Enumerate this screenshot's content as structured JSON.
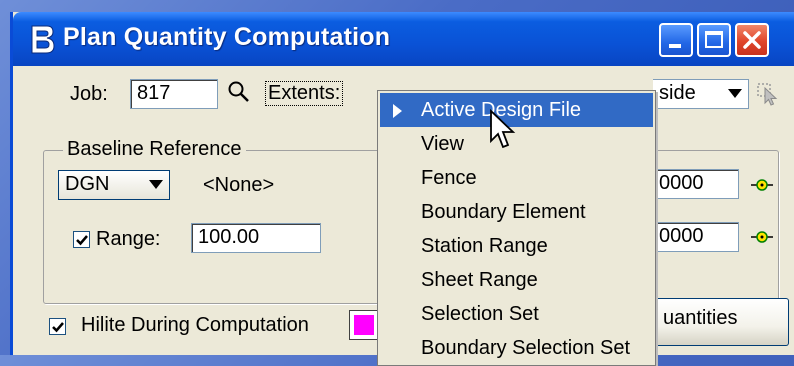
{
  "window": {
    "title": "Plan Quantity Computation"
  },
  "job": {
    "label": "Job:",
    "value": "817"
  },
  "extents": {
    "label": "Extents:",
    "selected_right_fragment": "side"
  },
  "baseline": {
    "group_label": "Baseline Reference",
    "source_value": "DGN",
    "element_value": "<None>",
    "range_checked": true,
    "range_label": "Range:",
    "range_value": "100.00",
    "right_field_1": "0000",
    "right_field_2": "0000"
  },
  "hilite": {
    "checked": true,
    "label": "Hilite During Computation",
    "color": "#ff00ff"
  },
  "quantities_button": {
    "label_fragment": "uantities"
  },
  "extents_menu": {
    "items": [
      {
        "label": "Active Design File",
        "selected": true
      },
      {
        "label": "View",
        "selected": false
      },
      {
        "label": "Fence",
        "selected": false
      },
      {
        "label": "Boundary Element",
        "selected": false
      },
      {
        "label": "Station Range",
        "selected": false
      },
      {
        "label": "Sheet Range",
        "selected": false
      },
      {
        "label": "Selection Set",
        "selected": false
      },
      {
        "label": "Boundary Selection Set",
        "selected": false
      }
    ]
  },
  "icons": {
    "app": "bentley-b-icon",
    "search": "magnifier-icon",
    "select": "arrow-select-icon",
    "target": "locate-target-icon"
  },
  "colors": {
    "titlebar": "#0a52d6",
    "menu_selection": "#316ac5",
    "dialog_bg": "#ece9d8"
  }
}
